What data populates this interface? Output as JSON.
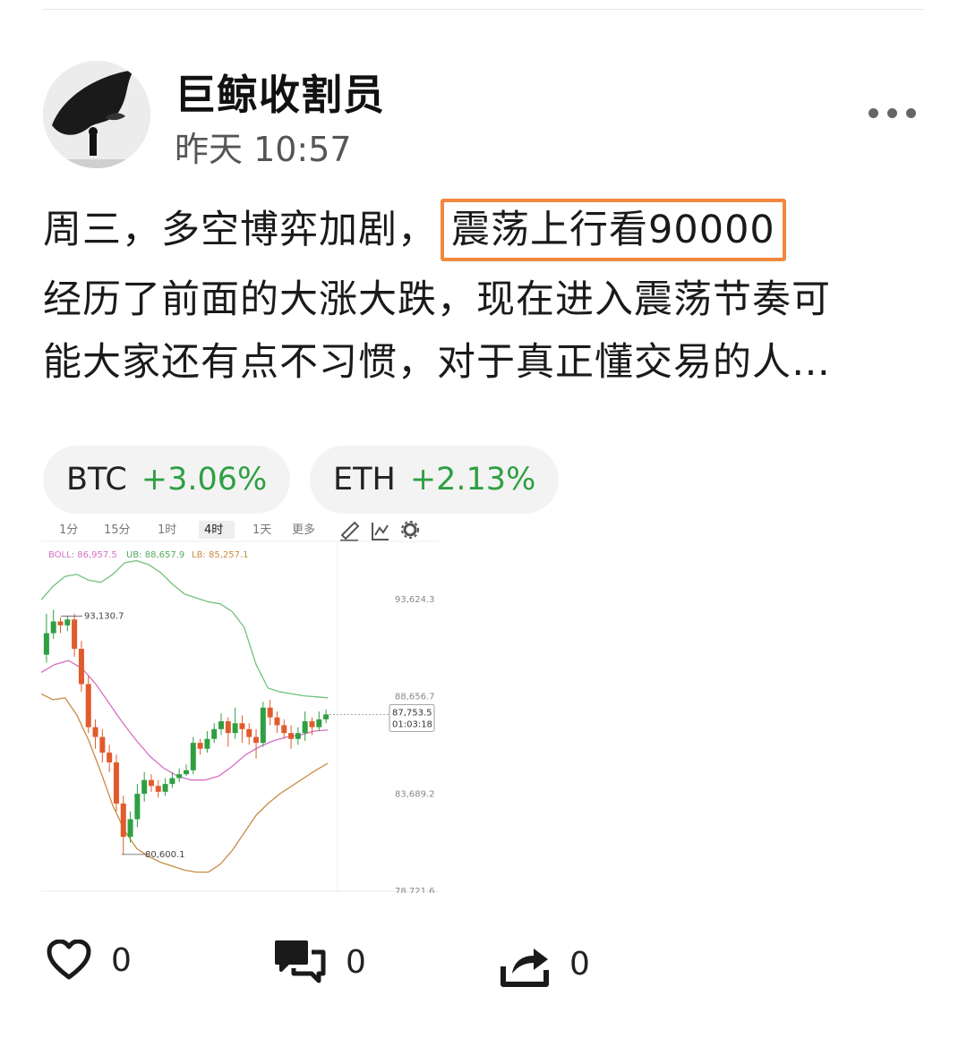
{
  "post": {
    "username": "巨鲸收割员",
    "timestamp": "昨天 10:57",
    "line1_prefix": "周三，多空博弈加剧，",
    "line1_highlight": "震荡上行看90000",
    "line2": "经历了前面的大涨大跌，现在进入震荡节奏可",
    "line3": "能大家还有点不习惯，对于真正懂交易的人…"
  },
  "tickers": [
    {
      "symbol": "BTC",
      "change": "+3.06%"
    },
    {
      "symbol": "ETH",
      "change": "+2.13%"
    }
  ],
  "chart_toolbar": {
    "intervals": [
      "1分",
      "15分",
      "1时",
      "4时",
      "1天",
      "更多"
    ],
    "active": "4时"
  },
  "chart_data": {
    "type": "candlestick",
    "indicator": {
      "boll_label": "BOLL: 86,957.5",
      "ub_label": "UB: 88,657.9",
      "lb_label": "LB: 85,257.1"
    },
    "y_ticks": [
      "93,624.3",
      "88,656.7",
      "83,689.2",
      "78,721.6"
    ],
    "y_tick_values": [
      93624.3,
      88656.7,
      83689.2,
      78721.6
    ],
    "ylim": [
      78721.6,
      95400
    ],
    "high_label": "93,130.7",
    "high_value": 93130.7,
    "low_label": "80,600.1",
    "low_value": 80600.1,
    "current_price": "87,753.5",
    "current_value": 87753.5,
    "countdown": "01:03:18",
    "candles": [
      [
        90800,
        91900,
        92900,
        90400
      ],
      [
        91900,
        92500,
        93100,
        91600
      ],
      [
        92500,
        92300,
        92700,
        91900
      ],
      [
        92300,
        92600,
        92800,
        92000
      ],
      [
        92600,
        91100,
        92900,
        90700
      ],
      [
        91100,
        89300,
        91500,
        88900
      ],
      [
        89300,
        87100,
        89700,
        86800
      ],
      [
        87100,
        86600,
        87500,
        86000
      ],
      [
        86600,
        85800,
        87000,
        85300
      ],
      [
        85800,
        85300,
        86200,
        84800
      ],
      [
        85300,
        83200,
        85700,
        82800
      ],
      [
        83200,
        81500,
        83600,
        80600
      ],
      [
        81500,
        82400,
        82800,
        81200
      ],
      [
        82400,
        83700,
        84200,
        82000
      ],
      [
        83700,
        84400,
        84800,
        83300
      ],
      [
        84400,
        84100,
        84700,
        83800
      ],
      [
        84100,
        83800,
        84400,
        83500
      ],
      [
        83800,
        84200,
        84500,
        83600
      ],
      [
        84200,
        84500,
        84800,
        84000
      ],
      [
        84500,
        84700,
        85000,
        84300
      ],
      [
        84700,
        84900,
        85200,
        84600
      ],
      [
        84900,
        86300,
        86600,
        84700
      ],
      [
        86300,
        86000,
        86500,
        85700
      ],
      [
        86000,
        86500,
        86900,
        85800
      ],
      [
        86500,
        87000,
        87300,
        86300
      ],
      [
        87000,
        87400,
        87800,
        86700
      ],
      [
        87400,
        86800,
        87600,
        86100
      ],
      [
        86800,
        87300,
        88100,
        86500
      ],
      [
        87300,
        87000,
        87700,
        86300
      ],
      [
        87000,
        86600,
        87300,
        86200
      ],
      [
        86600,
        86300,
        87000,
        85500
      ],
      [
        86300,
        88100,
        88400,
        86100
      ],
      [
        88100,
        87600,
        88500,
        87200
      ],
      [
        87600,
        87200,
        87900,
        86800
      ],
      [
        87200,
        86800,
        87500,
        86500
      ],
      [
        86800,
        86500,
        87200,
        86000
      ],
      [
        86500,
        86800,
        87100,
        86200
      ],
      [
        86800,
        87400,
        87900,
        86400
      ],
      [
        87400,
        87100,
        87600,
        86700
      ],
      [
        87100,
        87500,
        87900,
        86900
      ],
      [
        87500,
        87750,
        88000,
        87300
      ]
    ],
    "upper_band": [
      93600,
      94300,
      94800,
      94900,
      94600,
      94500,
      94900,
      95500,
      95600,
      95400,
      95000,
      94400,
      93900,
      93700,
      93500,
      93400,
      93000,
      92200,
      90300,
      89100,
      88900,
      88800,
      88700,
      88650,
      88600
    ],
    "middle_band": [
      89900,
      90300,
      90500,
      90100,
      89300,
      88300,
      87300,
      86400,
      85600,
      85000,
      84600,
      84400,
      84400,
      84600,
      85100,
      85700,
      86100,
      86400,
      86600,
      86700,
      86900,
      86950
    ],
    "lower_band": [
      88800,
      88500,
      88600,
      87700,
      86400,
      84800,
      83100,
      81800,
      80900,
      80500,
      80200,
      80000,
      79800,
      79700,
      79700,
      80100,
      80800,
      81700,
      82600,
      83200,
      83700,
      84100,
      84500,
      84900,
      85250
    ],
    "xlabel": "",
    "ylabel": ""
  },
  "actions": [
    {
      "name": "like",
      "count": "0"
    },
    {
      "name": "comment",
      "count": "0"
    },
    {
      "name": "share",
      "count": "0"
    }
  ],
  "colors": {
    "accent_highlight": "#f0883e",
    "up": "#2ea042",
    "down": "#e15b2d",
    "upper_band": "#73c17e",
    "middle_band": "#d66fc3",
    "lower_band": "#c98b45"
  }
}
